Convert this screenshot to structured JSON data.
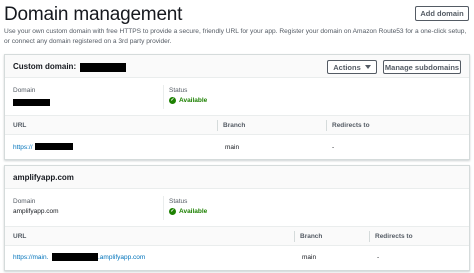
{
  "header": {
    "title": "Domain management",
    "add_domain_label": "Add domain",
    "description": "Use your own custom domain with free HTTPS to provide a secure, friendly URL for your app. Register your domain on Amazon Route53 for a one-click setup, or connect any domain registered on a 3rd party provider."
  },
  "custom_domain": {
    "title": "Custom domain:",
    "actions_label": "Actions",
    "manage_label": "Manage subdomains",
    "domain_label": "Domain",
    "status_label": "Status",
    "status_value": "Available",
    "columns": [
      "URL",
      "Branch",
      "Redirects to"
    ],
    "row": {
      "url_prefix": "https://",
      "branch": "main",
      "redirects": "-"
    }
  },
  "amplify_domain": {
    "title": "amplifyapp.com",
    "domain_label": "Domain",
    "domain_value": "amplifyapp.com",
    "status_label": "Status",
    "status_value": "Available",
    "columns": [
      "URL",
      "Branch",
      "Redirects to"
    ],
    "row": {
      "url_prefix": "https://main.",
      "url_suffix": ".amplifyapp.com",
      "branch": "main",
      "redirects": "-"
    }
  },
  "colors": {
    "available": "#1d8102",
    "link": "#0073bb",
    "border": "#d5dbdb"
  }
}
